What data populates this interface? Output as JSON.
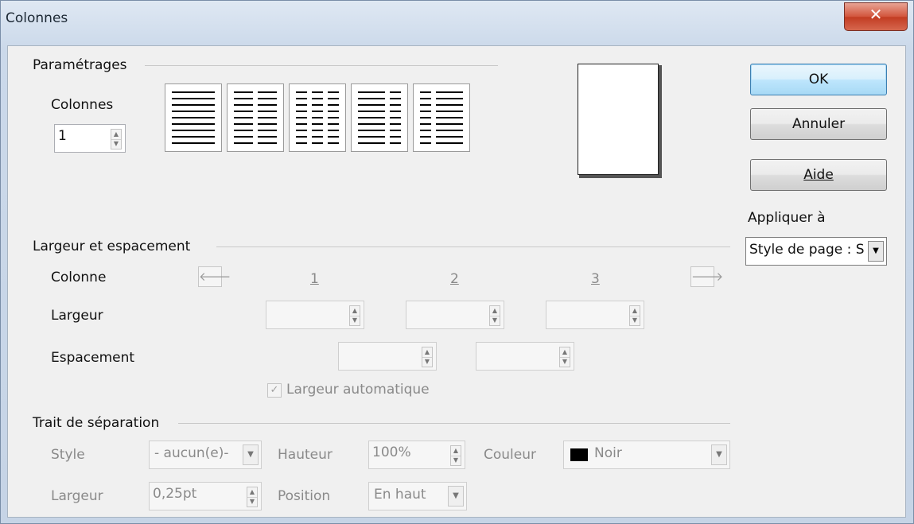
{
  "window": {
    "title": "Colonnes",
    "close_icon": "close-icon"
  },
  "settings": {
    "section_title": "Paramétrages",
    "columns_label": "Colonnes",
    "columns_value": "1",
    "presets": [
      "1 colonne",
      "2 colonnes",
      "3 colonnes",
      "2 colonnes (gauche plus large)",
      "2 colonnes (droite plus large)"
    ]
  },
  "buttons": {
    "ok": "OK",
    "cancel": "Annuler",
    "help": "Aide"
  },
  "apply_to": {
    "label": "Appliquer à",
    "value": "Style de page : S"
  },
  "width_spacing": {
    "section_title": "Largeur et espacement",
    "column_label": "Colonne",
    "width_label": "Largeur",
    "spacing_label": "Espacement",
    "column_numbers": [
      "1",
      "2",
      "3"
    ],
    "auto_width_label": "Largeur automatique",
    "auto_width_checked": true,
    "prev_icon": "arrow-left-icon",
    "next_icon": "arrow-right-icon"
  },
  "separator": {
    "section_title": "Trait de séparation",
    "style_label": "Style",
    "style_value": "- aucun(e)-",
    "height_label": "Hauteur",
    "height_value": "100%",
    "color_label": "Couleur",
    "color_value": "Noir",
    "color_swatch": "#000000",
    "width_label": "Largeur",
    "width_value": "0,25pt",
    "position_label": "Position",
    "position_value": "En haut"
  }
}
